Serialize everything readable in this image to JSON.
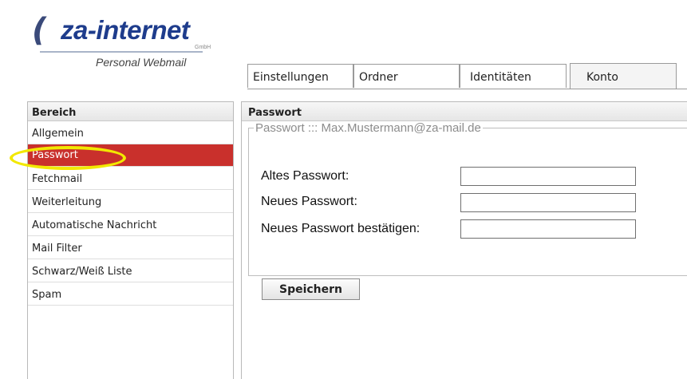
{
  "brand": {
    "name": "za-internet",
    "gmbh": "GmbH",
    "subtitle": "Personal Webmail"
  },
  "tabs": [
    {
      "label": "Einstellungen",
      "active": false
    },
    {
      "label": "Ordner",
      "active": false
    },
    {
      "label": "Identitäten",
      "active": false
    },
    {
      "label": "Konto",
      "active": true
    }
  ],
  "sidebar": {
    "header": "Bereich",
    "items": [
      {
        "label": "Allgemein",
        "active": false
      },
      {
        "label": "Passwort",
        "active": true
      },
      {
        "label": "Fetchmail",
        "active": false
      },
      {
        "label": "Weiterleitung",
        "active": false
      },
      {
        "label": "Automatische Nachricht",
        "active": false
      },
      {
        "label": "Mail Filter",
        "active": false
      },
      {
        "label": "Schwarz/Weiß Liste",
        "active": false
      },
      {
        "label": "Spam",
        "active": false
      }
    ]
  },
  "main": {
    "header": "Passwort",
    "legend": "Passwort ::: Max.Mustermann@za-mail.de",
    "fields": {
      "old_label": "Altes Passwort:",
      "old_value": "",
      "new_label": "Neues Passwort:",
      "new_value": "",
      "confirm_label": "Neues Passwort bestätigen:",
      "confirm_value": ""
    },
    "save_label": "Speichern"
  },
  "colors": {
    "brand_blue": "#1e3c8c",
    "active_item": "#c9302c",
    "highlight": "#f2e800"
  }
}
